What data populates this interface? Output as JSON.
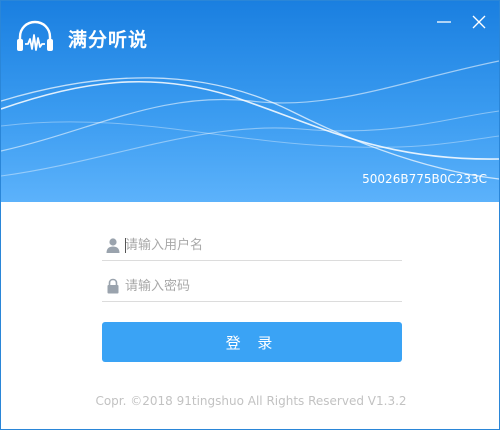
{
  "app": {
    "title": "满分听说",
    "logo_icon": "headphones-waveform-icon",
    "machine_code": "50026B775B0C233C"
  },
  "window_controls": {
    "minimize_icon": "minimize-icon",
    "close_icon": "close-icon"
  },
  "login": {
    "username_placeholder": "请输入用户名",
    "username_value": "",
    "username_icon": "user-icon",
    "password_placeholder": "请输入密码",
    "password_value": "",
    "password_icon": "lock-icon",
    "submit_label": "登 录"
  },
  "footer": {
    "copyright": "Copr. ©2018 91tingshuo All Rights Reserved V1.3.2"
  },
  "colors": {
    "header_top": "#1a7fe0",
    "header_bottom": "#5cb2fb",
    "button": "#3aa3f5",
    "copyright_text": "#c2c2c2"
  }
}
